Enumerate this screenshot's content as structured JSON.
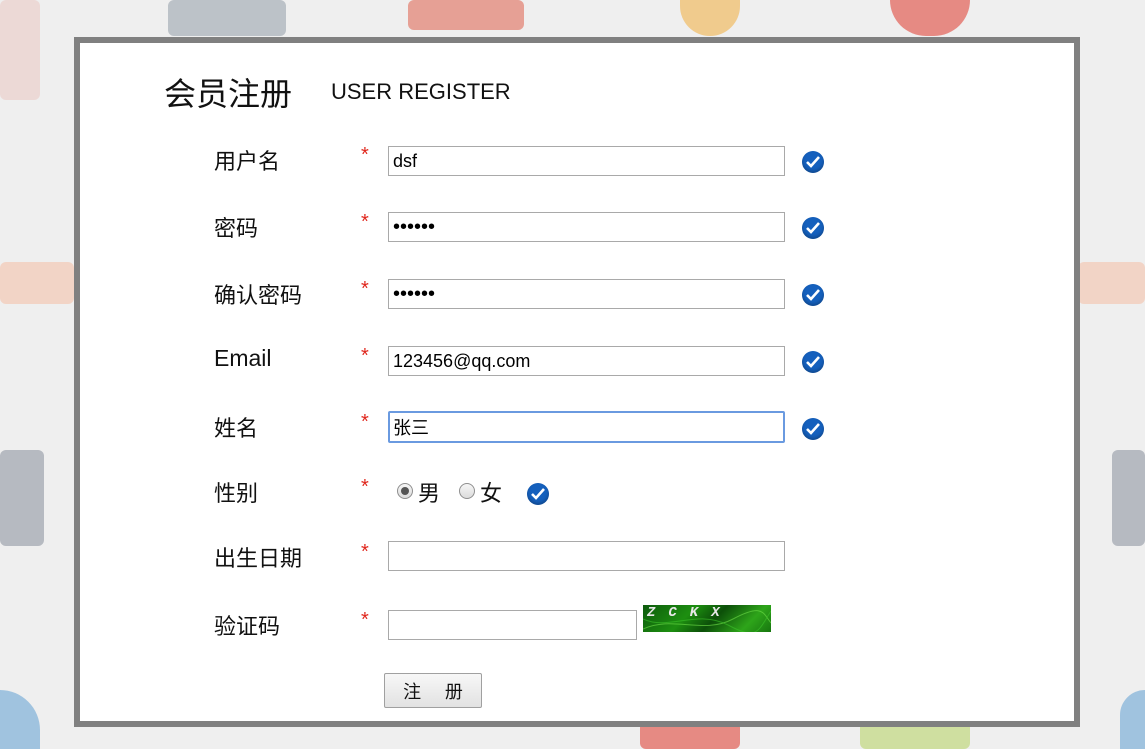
{
  "header": {
    "title_cn": "会员注册",
    "title_en": "USER REGISTER"
  },
  "required_mark": "*",
  "fields": {
    "username": {
      "label": "用户名",
      "value": "dsf"
    },
    "password": {
      "label": "密码",
      "value": "••••••"
    },
    "confirm_password": {
      "label": "确认密码",
      "value": "••••••"
    },
    "email": {
      "label": "Email",
      "value": "123456@qq.com"
    },
    "name": {
      "label": "姓名",
      "value": "张三"
    },
    "gender": {
      "label": "性别",
      "options": [
        "男",
        "女"
      ],
      "selected": "男"
    },
    "birthday": {
      "label": "出生日期",
      "value": ""
    },
    "captcha": {
      "label": "验证码",
      "value": "",
      "image_text": "ZCKX"
    }
  },
  "submit": {
    "label": "注 册"
  },
  "colors": {
    "check": "#1560bd",
    "required": "#e0261c",
    "focus": "#6a9ae0",
    "frame": "#808080"
  }
}
